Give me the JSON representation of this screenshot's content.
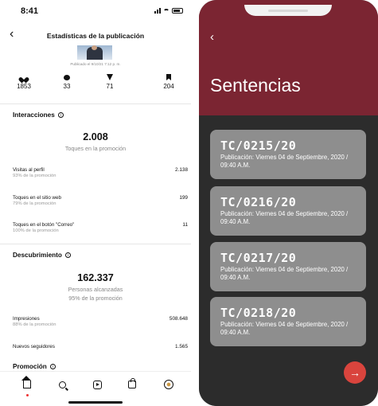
{
  "left": {
    "status": {
      "time": "8:41"
    },
    "header": {
      "title": "Estadísticas de la publicación"
    },
    "post": {
      "published": "Publicado el 9/10/21 7:12 p. m."
    },
    "metrics": [
      {
        "icon": "heart-icon",
        "value": "1853"
      },
      {
        "icon": "comment-icon",
        "value": "33"
      },
      {
        "icon": "send-icon",
        "value": "71"
      },
      {
        "icon": "bookmark-icon",
        "value": "204"
      }
    ],
    "interactions": {
      "title": "Interacciones",
      "total": "2.008",
      "total_label": "Toques en la promoción",
      "rows": [
        {
          "label": "Visitas al perfil",
          "sub": "93% de la promoción",
          "value": "2.138"
        },
        {
          "label": "Toques en el sitio web",
          "sub": "79% de la promoción",
          "value": "199"
        },
        {
          "label": "Toques en el botón \"Correo\"",
          "sub": "100% de la promoción",
          "value": "11"
        }
      ]
    },
    "discovery": {
      "title": "Descubrimiento",
      "total": "162.337",
      "total_label": "Personas alcanzadas",
      "total_sub": "95% de la promoción",
      "rows": [
        {
          "label": "Impresiones",
          "sub": "88% de la promoción",
          "value": "508.648"
        },
        {
          "label": "Nuevos seguidores",
          "sub": "",
          "value": "1.565"
        }
      ]
    },
    "promotion": {
      "title": "Promoción"
    },
    "tabbar": [
      "home-icon",
      "search-icon",
      "reels-icon",
      "shop-icon",
      "profile-icon"
    ]
  },
  "right": {
    "title": "Sentencias",
    "cards": [
      {
        "code": "TC/0215/20",
        "sub": "Publicación: Viernes 04 de Septiembre, 2020 / 09:40 A.M."
      },
      {
        "code": "TC/0216/20",
        "sub": "Publicación: Viernes 04 de Septiembre, 2020 / 09:40 A.M."
      },
      {
        "code": "TC/0217/20",
        "sub": "Publicación: Viernes 04 de Septiembre, 2020 / 09:40 A.M."
      },
      {
        "code": "TC/0218/20",
        "sub": "Publicación: Viernes 04 de Septiembre, 2020 / 09:40 A.M."
      }
    ],
    "colors": {
      "header": "#7b2532",
      "body": "#2c2c2c",
      "card": "#8e8e8e",
      "fab": "#d9443d"
    }
  }
}
